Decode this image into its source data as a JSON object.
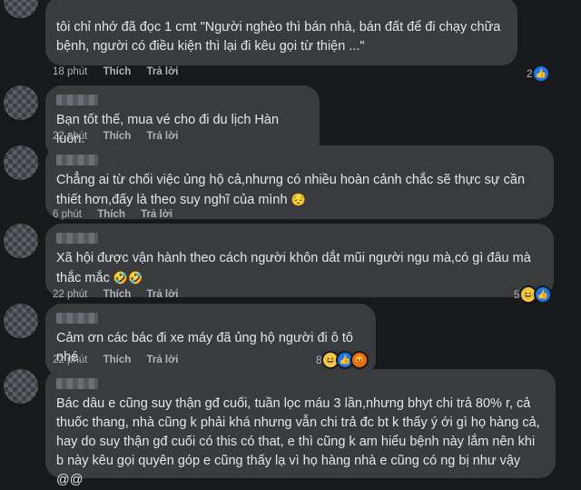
{
  "comments": [
    {
      "text": "tôi chỉ nhớ đã đọc 1 cmt \"Người nghèo thì bán nhà, bán đất để đi chạy chữa bệnh, người có điều kiện thì lại đi kêu gọi từ thiện ...\"",
      "time": "18 phút",
      "like": "Thích",
      "reply": "Trả lời",
      "reaction_count": "2",
      "reactions": [
        "like-icon"
      ]
    },
    {
      "text": "Bạn tốt thế, mua vé cho đi du lịch Hàn luôn.",
      "time": "22 phút",
      "like": "Thích",
      "reply": "Trả lời"
    },
    {
      "text": "Chẳng ai từ chối việc ủng hộ cả,nhưng có nhiều hoàn cảnh chắc sẽ thực sự cần thiết hơn,đấy là theo suy nghĩ của mình",
      "emoji": "😔",
      "time": "6 phút",
      "like": "Thích",
      "reply": "Trả lời"
    },
    {
      "text": "Xã hội được vận hành theo cách người khôn dắt mũi người ngu mà,có gì đâu mà thắc mắc",
      "emoji": "🤣🤣",
      "time": "22 phút",
      "like": "Thích",
      "reply": "Trả lời",
      "reaction_count": "5",
      "reactions": [
        "haha-icon",
        "like-icon"
      ]
    },
    {
      "text": "Cảm ơn các bác đi xe máy đã ủng hộ người đi ô tô nhé.",
      "time": "22 phút",
      "like": "Thích",
      "reply": "Trả lời",
      "reaction_count": "8",
      "reactions": [
        "haha-icon",
        "like-icon",
        "angry-icon"
      ]
    },
    {
      "text": "Bác dâu e cũng suy thận gđ cuối, tuần lọc máu 3 lần,nhưng bhyt chi trả 80% r, cả thuốc thang, nhà cũng k phải khá nhưng vẫn chi trả đc bt k thấy ý ới gì họ hàng cả, hay do suy thận gđ cuối có this có that, e thì cũng k am hiểu bệnh này lắm nên khi b này kêu gọi quyên góp e cũng thấy lạ vì họ hàng nhà e cũng có ng bị như vậy @@"
    }
  ],
  "icon_glyphs": {
    "like": "👍",
    "haha": "😆",
    "angry": "😡"
  },
  "colors": {
    "background": "#18191a",
    "bubble": "#3a3b3c",
    "text": "#e4e6eb",
    "meta": "#b0b3b8",
    "like_blue": "#1877f2"
  }
}
